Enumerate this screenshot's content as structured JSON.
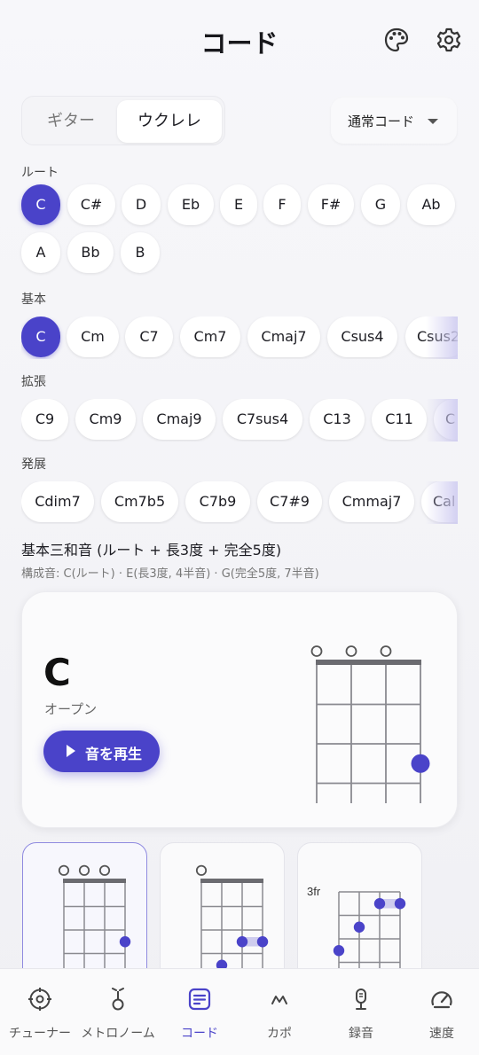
{
  "header": {
    "title": "コード",
    "icons": [
      "palette-icon",
      "gear-icon"
    ]
  },
  "instrument_toggle": {
    "options": [
      "ギター",
      "ウクレレ"
    ],
    "selected": "ウクレレ"
  },
  "chord_type_dropdown": {
    "value": "通常コード"
  },
  "root": {
    "label": "ルート",
    "items": [
      "C",
      "C#",
      "D",
      "Eb",
      "E",
      "F",
      "F#",
      "G",
      "Ab",
      "A",
      "Bb",
      "B"
    ],
    "selected": "C"
  },
  "basic": {
    "label": "基本",
    "items": [
      "C",
      "Cm",
      "C7",
      "Cm7",
      "Cmaj7",
      "Csus4",
      "Csus2"
    ],
    "selected": "C"
  },
  "extended": {
    "label": "拡張",
    "items": [
      "C9",
      "Cm9",
      "Cmaj9",
      "C7sus4",
      "C13",
      "C11",
      "C"
    ]
  },
  "advanced": {
    "label": "発展",
    "items": [
      "Cdim7",
      "Cm7b5",
      "C7b9",
      "C7#9",
      "Cmmaj7",
      "Cal"
    ]
  },
  "chord_info": {
    "description": "基本三和音 (ルート + 長3度 + 完全5度)",
    "notes": "構成音: C(ルート) · E(長3度, 4半音) · G(完全5度, 7半音)"
  },
  "main_card": {
    "chord_name": "C",
    "position": "オープン",
    "play_label": "音を再生",
    "diagram": {
      "open_strings": [
        1,
        2,
        3
      ],
      "dots": [
        {
          "string": 4,
          "fret": 3
        }
      ]
    }
  },
  "voicings": [
    {
      "selected": true,
      "open_strings": [
        1,
        2,
        3
      ],
      "dots": [
        {
          "string": 4,
          "fret": 3
        }
      ]
    },
    {
      "selected": false,
      "open_strings": [
        1
      ],
      "dots": [
        {
          "string": 3,
          "fret": 3
        },
        {
          "string": 4,
          "fret": 3
        },
        {
          "string": 2,
          "fret": 4
        }
      ]
    },
    {
      "selected": false,
      "fret_label": "3fr",
      "dots": [
        {
          "string": 3,
          "fret": 1
        },
        {
          "string": 4,
          "fret": 1
        },
        {
          "string": 2,
          "fret": 2
        },
        {
          "string": 1,
          "fret": 3
        }
      ]
    }
  ],
  "colors": {
    "accent": "#4a43c9",
    "background": "#f3f3f6",
    "card": "#fbfbfc"
  },
  "bottom_nav": {
    "items": [
      {
        "label": "チューナー",
        "icon": "tuner-icon"
      },
      {
        "label": "メトロノーム",
        "icon": "metronome-icon"
      },
      {
        "label": "コード",
        "icon": "chord-sheet-icon",
        "active": true
      },
      {
        "label": "カポ",
        "icon": "capo-icon"
      },
      {
        "label": "録音",
        "icon": "microphone-icon"
      },
      {
        "label": "速度",
        "icon": "speedometer-icon"
      }
    ]
  }
}
